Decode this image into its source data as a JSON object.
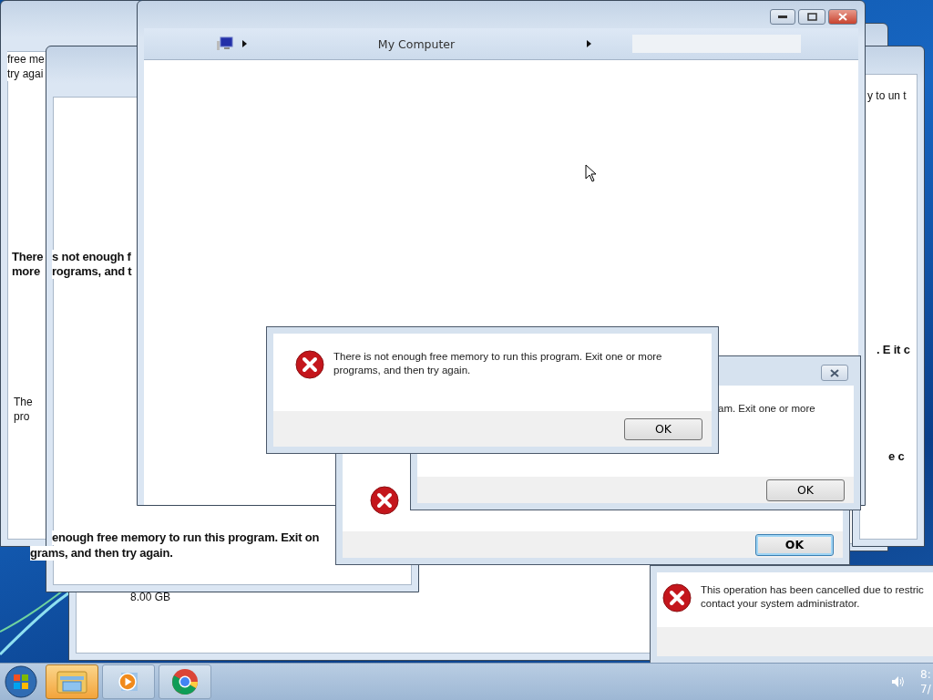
{
  "fragments": [
    {
      "bold": false,
      "lines": [
        "free me",
        "try agai"
      ]
    },
    {
      "bold": false,
      "lines": [
        "y to un t"
      ]
    },
    {
      "bold": true,
      "lines": [
        "There",
        "more"
      ]
    },
    {
      "bold": true,
      "lines": [
        "s not enough f",
        "rograms, and t"
      ]
    },
    {
      "bold": true,
      "lines": [
        ". E it c"
      ]
    },
    {
      "bold": false,
      "lines": [
        "The",
        "pro"
      ]
    },
    {
      "bold": true,
      "lines": [
        "e c"
      ]
    },
    {
      "bold": false,
      "lines": [
        "8.00 GB"
      ]
    },
    {
      "bold": true,
      "lines": [
        "enough free memory to run this program. Exit on"
      ]
    },
    {
      "bold": true,
      "lines": [
        "grams, and then try again."
      ]
    }
  ],
  "explorer": {
    "address": "My Computer"
  },
  "dialogs": [
    {
      "lines": [
        "There is not enough free memory to run this program. Exit one or more",
        "programs, and then try again."
      ],
      "buttons": [
        {
          "label": "OK",
          "focused": false
        }
      ]
    },
    {
      "lines": [
        "am. Exit one or more"
      ],
      "buttons": [
        {
          "label": "OK",
          "focused": false
        }
      ]
    },
    {
      "buttons": [
        {
          "label": "OK",
          "focused": true
        }
      ]
    },
    {
      "lines": [
        "This operation has been cancelled due to restric",
        "contact your system administrator."
      ]
    }
  ],
  "taskbar": {
    "items": [
      {
        "kind": "explorer",
        "selected": true
      },
      {
        "kind": "media",
        "selected": false
      },
      {
        "kind": "browser",
        "selected": false
      }
    ],
    "time": "8:",
    "date": "7/"
  }
}
